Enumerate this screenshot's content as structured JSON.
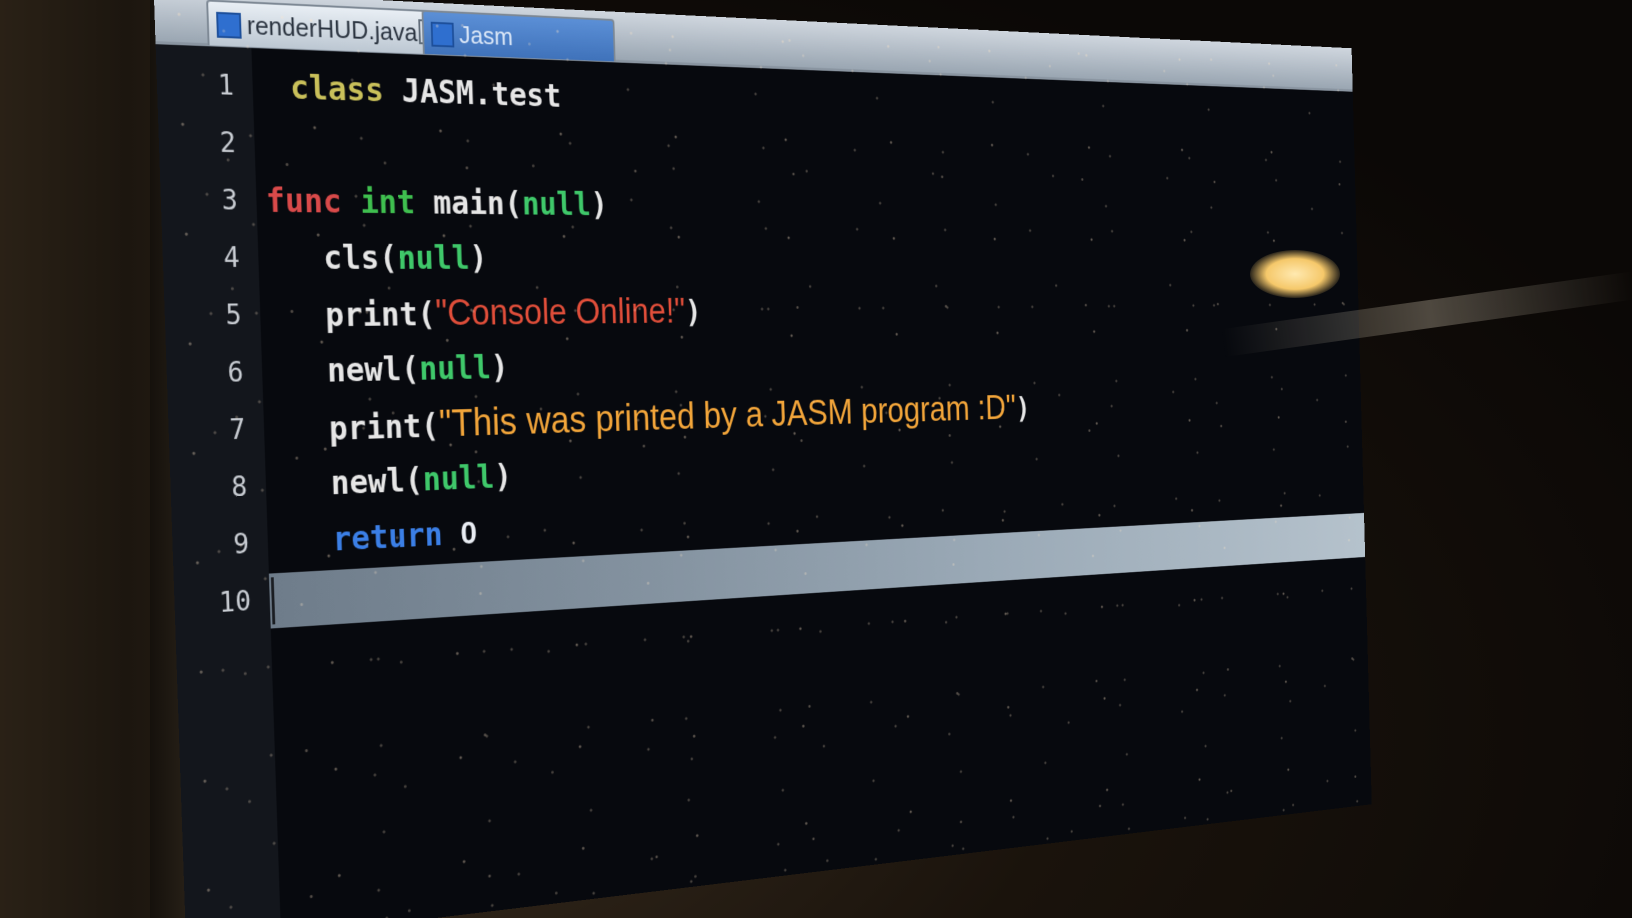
{
  "tabs": [
    {
      "label": "renderHUD.java",
      "close": "×"
    },
    {
      "label": "Jasm"
    }
  ],
  "lines": [
    {
      "num": "1"
    },
    {
      "num": "2"
    },
    {
      "num": "3"
    },
    {
      "num": "4"
    },
    {
      "num": "5"
    },
    {
      "num": "6"
    },
    {
      "num": "7"
    },
    {
      "num": "8"
    },
    {
      "num": "9"
    },
    {
      "num": "10"
    }
  ],
  "code": {
    "l1_kw": "class",
    "l1_rest": " JASM.test",
    "l3_kw": "func",
    "l3_type": "int",
    "l3_name": " main(",
    "l3_null": "null",
    "l3_close": ")",
    "l4_call": "cls(",
    "l4_null": "null",
    "l4_close": ")",
    "l5_call": "print(",
    "l5_str": "\"Console Online!\"",
    "l5_close": ")",
    "l6_call": "newl(",
    "l6_null": "null",
    "l6_close": ")",
    "l7_call": "print(",
    "l7_str": "\"This was printed by a JASM program :D\"",
    "l7_close": ")",
    "l8_call": "newl(",
    "l8_null": "null",
    "l8_close": ")",
    "l9_kw": "return",
    "l9_num": "0"
  },
  "colors": {
    "keyword_class": "#c9c05a",
    "keyword_func": "#d94a4a",
    "type_int": "#3fbf4f",
    "null_literal": "#3fc86a",
    "keyword_return": "#3b7fe6",
    "string_1": "#e04e3a",
    "string_2": "#f2a53a",
    "current_line": "#9aa9b6"
  },
  "icons": {
    "tab_file": "java-file-icon",
    "tab_close": "close-icon"
  }
}
